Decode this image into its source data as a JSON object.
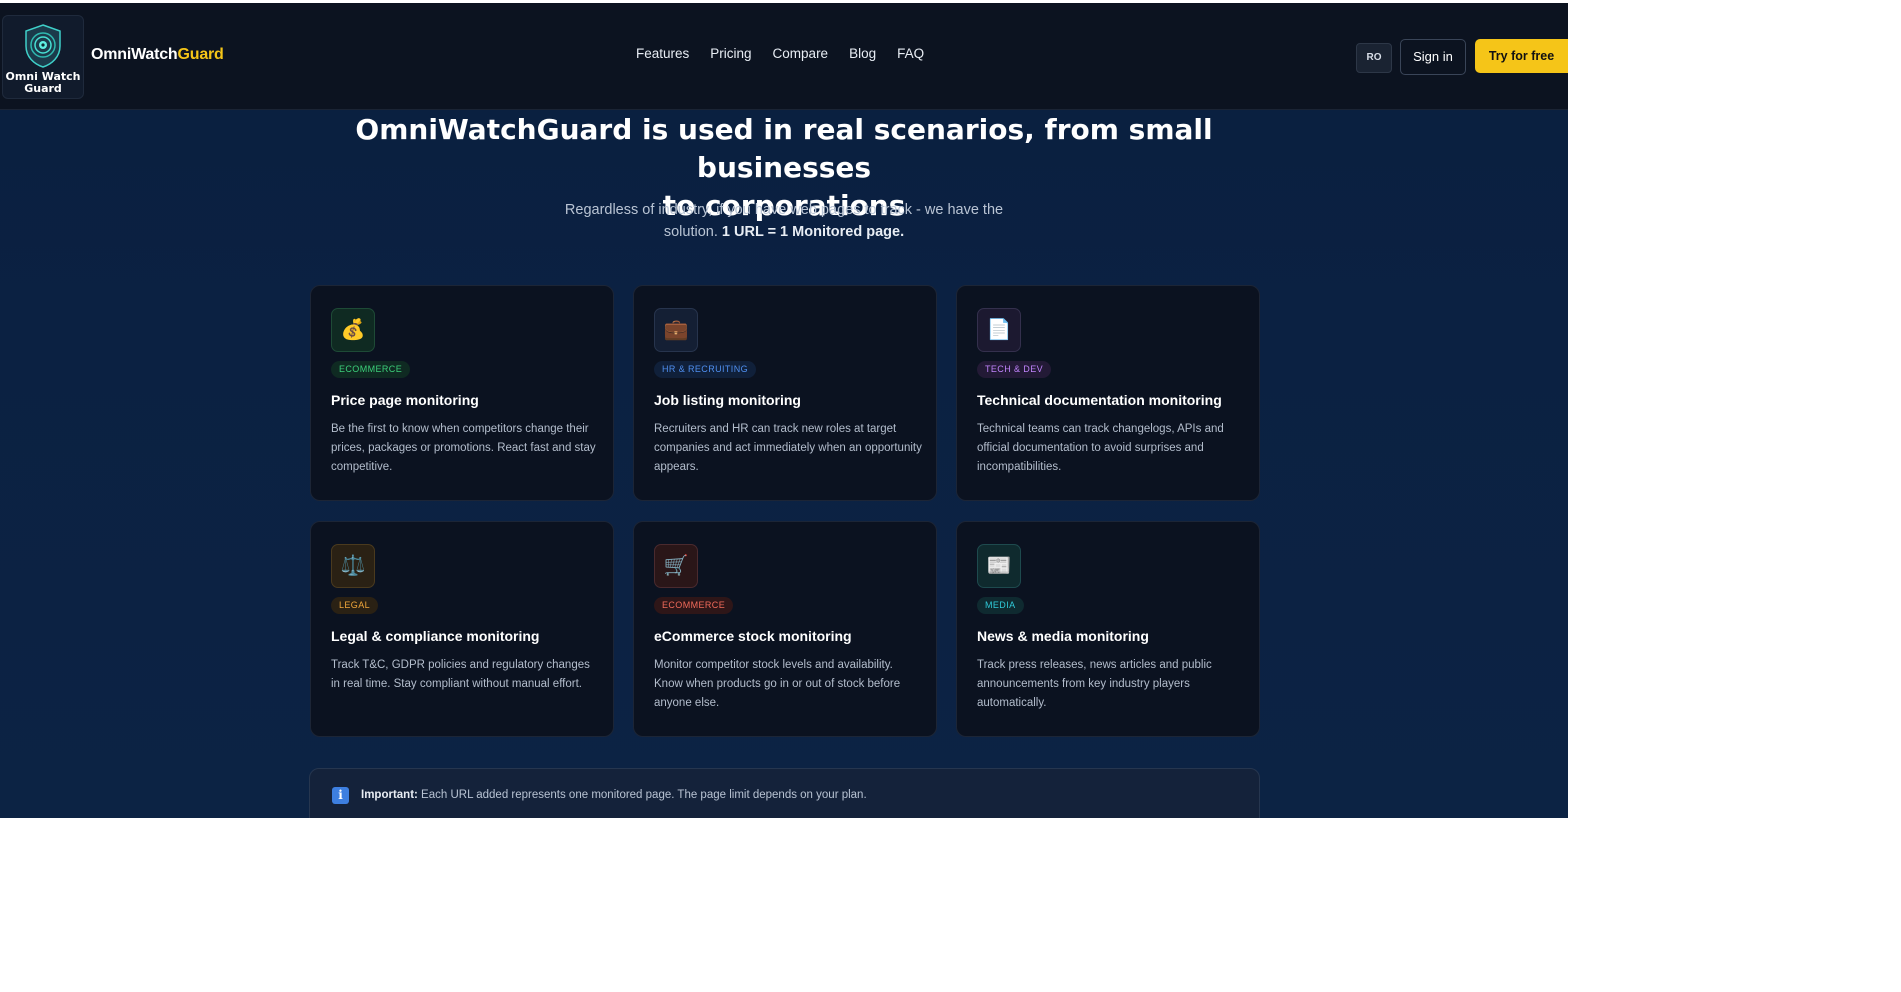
{
  "brand": {
    "logo_text_line1": "Omni Watch",
    "logo_text_line2": "Guard",
    "name_main": "OmniWatch",
    "name_accent": "Guard"
  },
  "nav": {
    "items": [
      "Features",
      "Pricing",
      "Compare",
      "Blog",
      "FAQ"
    ]
  },
  "header_actions": {
    "lang": "RO",
    "signin": "Sign in",
    "try": "Try for free"
  },
  "hero": {
    "title_line1": "OmniWatchGuard is used in real scenarios, from small businesses",
    "title_line2": "to corporations",
    "subtitle_line1": "Regardless of industry, if you have web pages to track - we have the",
    "subtitle_line2_plain": "solution.",
    "subtitle_line2_bold": "1 URL = 1 Monitored page."
  },
  "cards": [
    {
      "icon": "money-bag-icon",
      "glyph": "💰",
      "tag": "ECOMMERCE",
      "tag_color": "#3ccf7a",
      "tag_bg": "#0f2a22",
      "icon_bg": "#0f2a22",
      "icon_border": "#1e4a36",
      "title": "Price page monitoring",
      "desc": "Be the first to know when competitors change their prices, packages or promotions. React fast and stay competitive."
    },
    {
      "icon": "briefcase-icon",
      "glyph": "💼",
      "tag": "HR & RECRUITING",
      "tag_color": "#4f8ff0",
      "tag_bg": "#10203a",
      "icon_bg": "#141f34",
      "icon_border": "#27344d",
      "title": "Job listing monitoring",
      "desc": "Recruiters and HR can track new roles at target companies and act immediately when an opportunity appears."
    },
    {
      "icon": "document-icon",
      "glyph": "📄",
      "tag": "TECH & DEV",
      "tag_color": "#c084fc",
      "tag_bg": "#231a36",
      "icon_bg": "#1c1930",
      "icon_border": "#34304d",
      "title": "Technical documentation monitoring",
      "desc": "Technical teams can track changelogs, APIs and official documentation to avoid surprises and incompatibilities."
    },
    {
      "icon": "scales-icon",
      "glyph": "⚖️",
      "tag": "LEGAL",
      "tag_color": "#f0a63a",
      "tag_bg": "#2a2114",
      "icon_bg": "#2a2114",
      "icon_border": "#4a3a1e",
      "title": "Legal & compliance monitoring",
      "desc": "Track T&C, GDPR policies and regulatory changes in real time. Stay compliant without manual effort."
    },
    {
      "icon": "shopping-cart-icon",
      "glyph": "🛒",
      "tag": "ECOMMERCE",
      "tag_color": "#f06a5a",
      "tag_bg": "#2e1618",
      "icon_bg": "#2a1618",
      "icon_border": "#4a2a2e",
      "title": "eCommerce stock monitoring",
      "desc": "Monitor competitor stock levels and availability. Know when products go in or out of stock before anyone else."
    },
    {
      "icon": "newspaper-icon",
      "glyph": "📰",
      "tag": "MEDIA",
      "tag_color": "#2fc9d8",
      "tag_bg": "#0f2a30",
      "icon_bg": "#0f2a2e",
      "icon_border": "#1e4a4e",
      "title": "News & media monitoring",
      "desc": "Track press releases, news articles and public announcements from key industry players automatically."
    }
  ],
  "note": {
    "icon": "info-icon",
    "glyph": "i",
    "label": "Important:",
    "text": " Each URL added represents one monitored page. The page limit depends on your plan."
  }
}
